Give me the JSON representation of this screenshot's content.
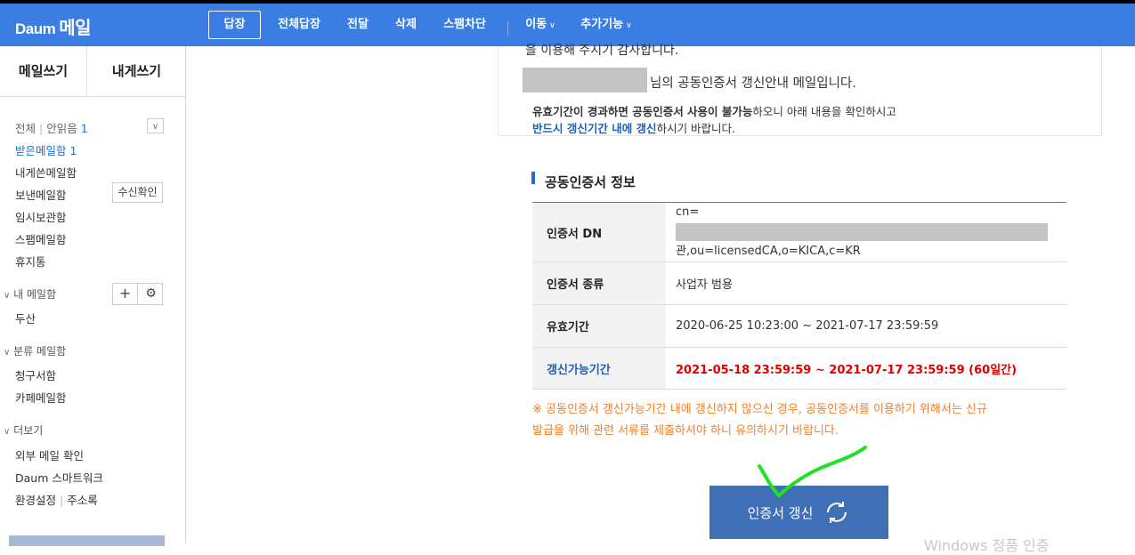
{
  "header": {
    "logo_brand": "Daum",
    "logo_text": "메일",
    "buttons": {
      "reply": "답장",
      "reply_all": "전체답장",
      "forward": "전달",
      "delete": "삭제",
      "block_spam": "스팸차단",
      "move": "이동",
      "more": "추가기능"
    }
  },
  "sidebar": {
    "compose": "메일쓰기",
    "self_compose": "내게쓰기",
    "filter_all": "전체",
    "filter_unread": "안읽음",
    "unread_count": "1",
    "folders": {
      "inbox": "받은메일함",
      "inbox_count": "1",
      "self_sent": "내게쓴메일함",
      "sent": "보낸메일함",
      "receipt_check": "수신확인",
      "drafts": "임시보관함",
      "spam": "스팸메일함",
      "trash": "휴지통"
    },
    "my_mailbox": "내 메일함",
    "my_folder_doosan": "두산",
    "category_mailbox": "분류 메일함",
    "category_billing": "청구서함",
    "category_cafe": "카페메일함",
    "more_section": "더보기",
    "external_mail": "외부 메일 확인",
    "smartwork": "Daum 스마트워크",
    "settings": "환경설정",
    "addressbook": "주소록"
  },
  "mail": {
    "cut_text": "을 이용해 주시기 감사합니다.",
    "greeting_suffix": "님의 공동인증서 갱신안내 메일입니다.",
    "notice1_bold": "유효기간이 경과하면 공동인증서 사용이 불가능",
    "notice1_rest": "하오니 아래 내용을 확인하시고",
    "notice2_bold": "반드시 갱신기간 내에 갱신",
    "notice2_rest": "하시기 바랍니다.",
    "section_title": "공동인증서 정보",
    "rows": {
      "dn_label": "인증서 DN",
      "dn_prefix": "cn=",
      "dn_suffix": "관,ou=licensedCA,o=KICA,c=KR",
      "type_label": "인증서 종류",
      "type_value": "사업자 범용",
      "validity_label": "유효기간",
      "validity_value": "2020-06-25 10:23:00 ~ 2021-07-17 23:59:59",
      "renew_period_label": "갱신가능기간",
      "renew_period_value": "2021-05-18 23:59:59 ~ 2021-07-17 23:59:59 (60일간)"
    },
    "warning_line1": "※ 공동인증서 갱신가능기간 내에 갱신하지 않으신 경우, 공동인증서를 이용하기 위해서는 신규",
    "warning_line2": "발급을 위해 관련 서류를 제출하셔야 하니 유의하시기 바랍니다.",
    "renew_button": "인증서 갱신"
  },
  "watermark": "Windows 정품 인증",
  "colors": {
    "topbar": "#3a7de3",
    "link_blue": "#1a73d4",
    "warning_orange": "#f07f2a",
    "red_text": "#e00000",
    "renew_button": "#3f6fb5",
    "scribble": "#22e022"
  }
}
